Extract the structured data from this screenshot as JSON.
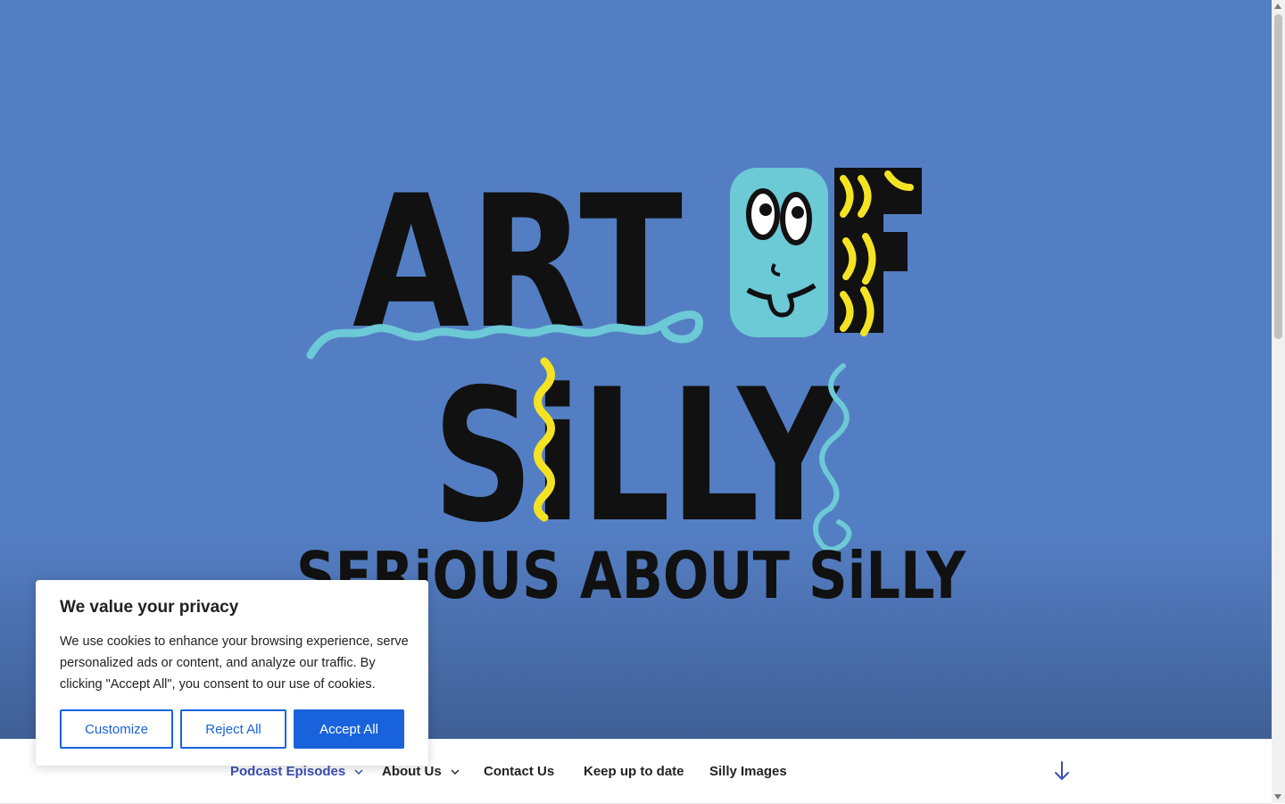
{
  "hero": {
    "logo_line1": "ART",
    "logo_of": "OF",
    "logo_line2": "SiLLY",
    "tagline": "SERiOUS ABOUT SiLLY",
    "colors": {
      "background": "#547ec3",
      "ink": "#111111",
      "cyan": "#6cc9d6",
      "yellow": "#f4e323"
    }
  },
  "nav": {
    "items": [
      {
        "label": "Podcast Episodes",
        "has_dropdown": true,
        "active": true
      },
      {
        "label": "About Us",
        "has_dropdown": true,
        "active": false
      },
      {
        "label": "Contact Us",
        "has_dropdown": false,
        "active": false
      },
      {
        "label": "Keep up to date",
        "has_dropdown": false,
        "active": false
      },
      {
        "label": "Silly Images",
        "has_dropdown": false,
        "active": false
      }
    ],
    "scroll_icon": "arrow-down-icon"
  },
  "cookie": {
    "title": "We value your privacy",
    "body": "We use cookies to enhance your browsing experience, serve personalized ads or content, and analyze our traffic. By clicking \"Accept All\", you consent to our use of cookies.",
    "customize_label": "Customize",
    "reject_label": "Reject All",
    "accept_label": "Accept All",
    "accent_color": "#1863dc"
  }
}
